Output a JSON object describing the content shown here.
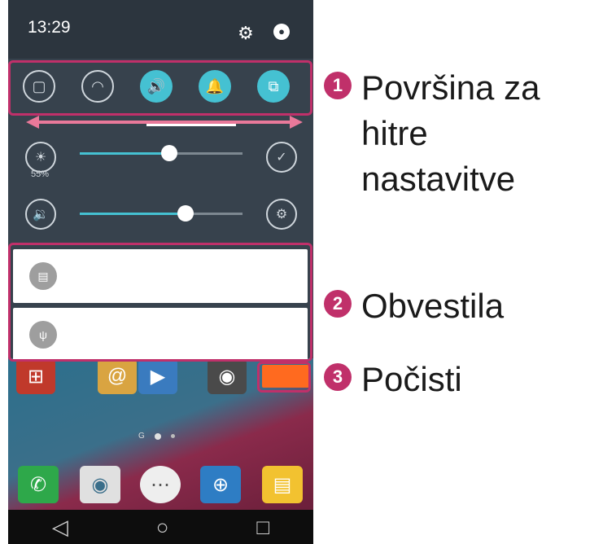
{
  "status_bar": {
    "time": "13:29",
    "icons": [
      "gear-icon",
      "user-icon"
    ]
  },
  "quick_settings": {
    "tiles": [
      {
        "name": "capture-icon",
        "glyph": "▢",
        "on": false
      },
      {
        "name": "wifi-icon",
        "glyph": "◠",
        "on": false
      },
      {
        "name": "sound-icon",
        "glyph": "🔊",
        "on": true
      },
      {
        "name": "notification-bell-icon",
        "glyph": "🔔",
        "on": true
      },
      {
        "name": "screen-share-icon",
        "glyph": "⧉",
        "on": true
      }
    ]
  },
  "brightness": {
    "percent_label": "55%",
    "level": 0.55
  },
  "volume": {
    "level": 0.65
  },
  "colors": {
    "accent": "#45c1d2",
    "highlight": "#c0306a"
  },
  "callouts": [
    {
      "number": "1",
      "text_line1": "Površina za hitre",
      "text_line2": "nastavitve"
    },
    {
      "number": "2",
      "text_line1": "Obvestila"
    },
    {
      "number": "3",
      "text_line1": "Počisti"
    }
  ],
  "navbar": {
    "back": "◁",
    "home": "○",
    "recents": "□"
  },
  "dots_label": "G"
}
